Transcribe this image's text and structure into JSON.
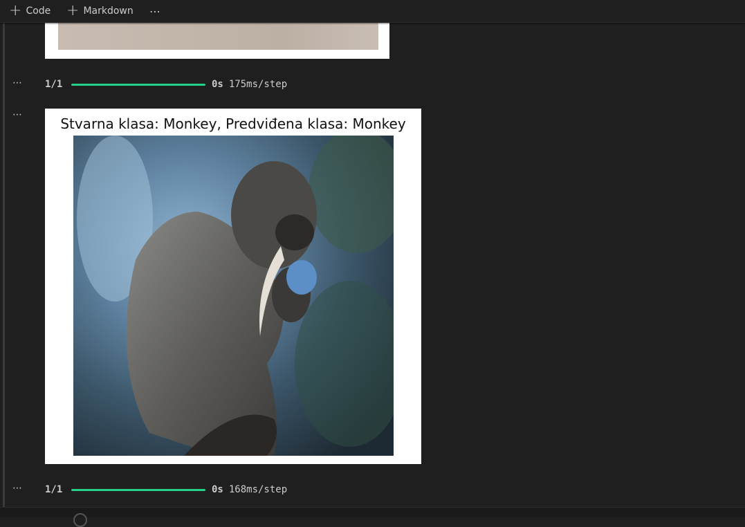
{
  "toolbar": {
    "code_label": "Code",
    "markdown_label": "Markdown",
    "more_label": "⋯"
  },
  "cells": {
    "ellipsis": "⋯"
  },
  "progress": [
    {
      "count": "1/1",
      "fill": 1.0,
      "time": "0s",
      "rate": "175ms/step"
    },
    {
      "count": "1/1",
      "fill": 1.0,
      "time": "0s",
      "rate": "168ms/step"
    }
  ],
  "figure": {
    "title": "Stvarna klasa: Monkey, Predviđena klasa: Monkey",
    "image_subject": "monkey-photo"
  },
  "colors": {
    "background": "#1f1f1f",
    "progress_bar": "#23d18b",
    "text": "#cccccc"
  }
}
